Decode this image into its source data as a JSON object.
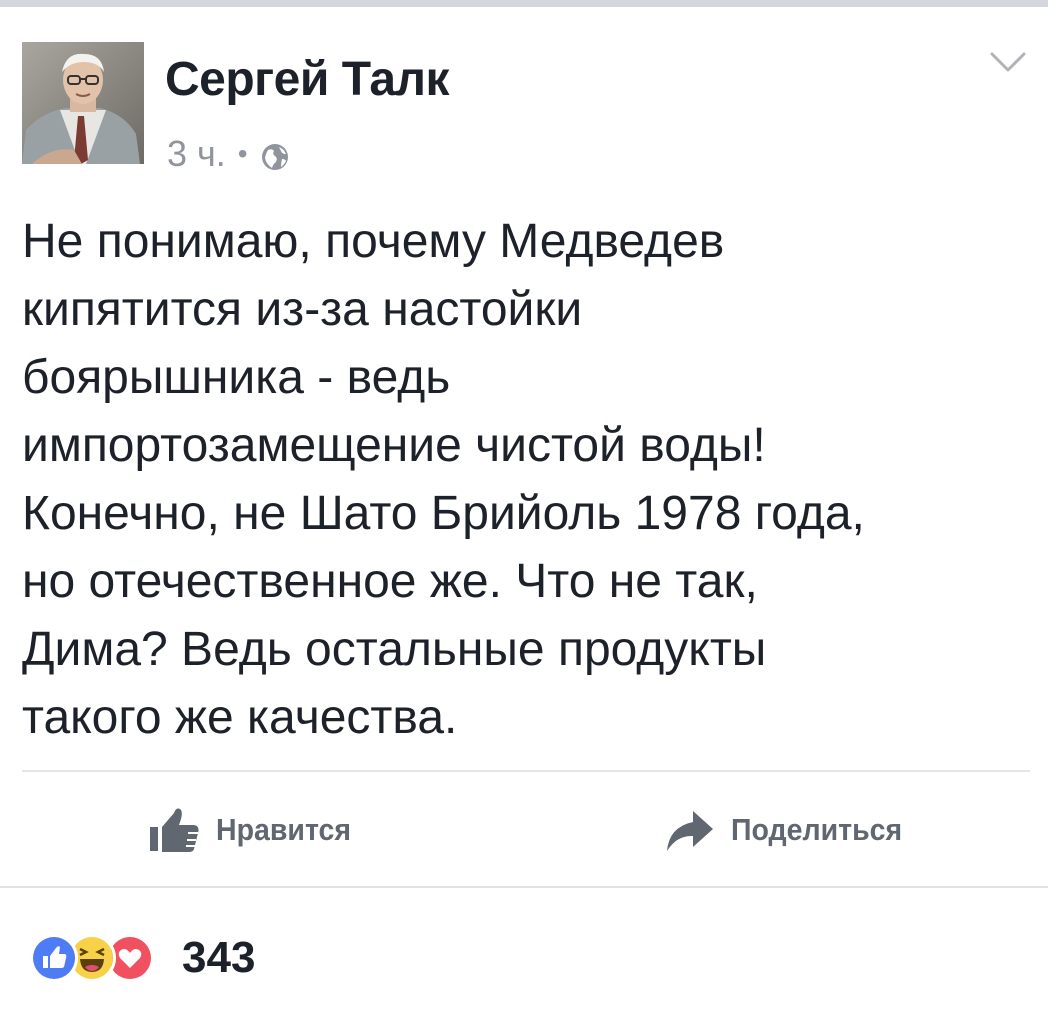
{
  "post": {
    "author": "Сергей Талк",
    "timestamp": "3 ч.",
    "separator": "•",
    "privacy_icon": "globe-icon",
    "menu_icon": "chevron-down-icon",
    "text": "Не понимаю, почему Медведев\nкипятится из-за настойки\nбоярышника - ведь\nимпортозамещение чистой воды!\nКонечно, не Шато Брийоль 1978 года,\nно отечественное же. Что не так,\nДима? Ведь остальные продукты\nтакого же качества."
  },
  "actions": {
    "like": {
      "label": "Нравится",
      "icon": "thumbs-up-icon"
    },
    "share": {
      "label": "Поделиться",
      "icon": "share-arrow-icon"
    }
  },
  "reactions": {
    "icons": [
      "like-reaction-icon",
      "haha-reaction-icon",
      "love-reaction-icon"
    ],
    "count": "343"
  },
  "colors": {
    "text": "#1d2129",
    "meta": "#90949c",
    "action": "#606770",
    "like_blue": "#4d7cf4",
    "haha_yellow": "#f7d147",
    "love_red": "#f0505f"
  }
}
